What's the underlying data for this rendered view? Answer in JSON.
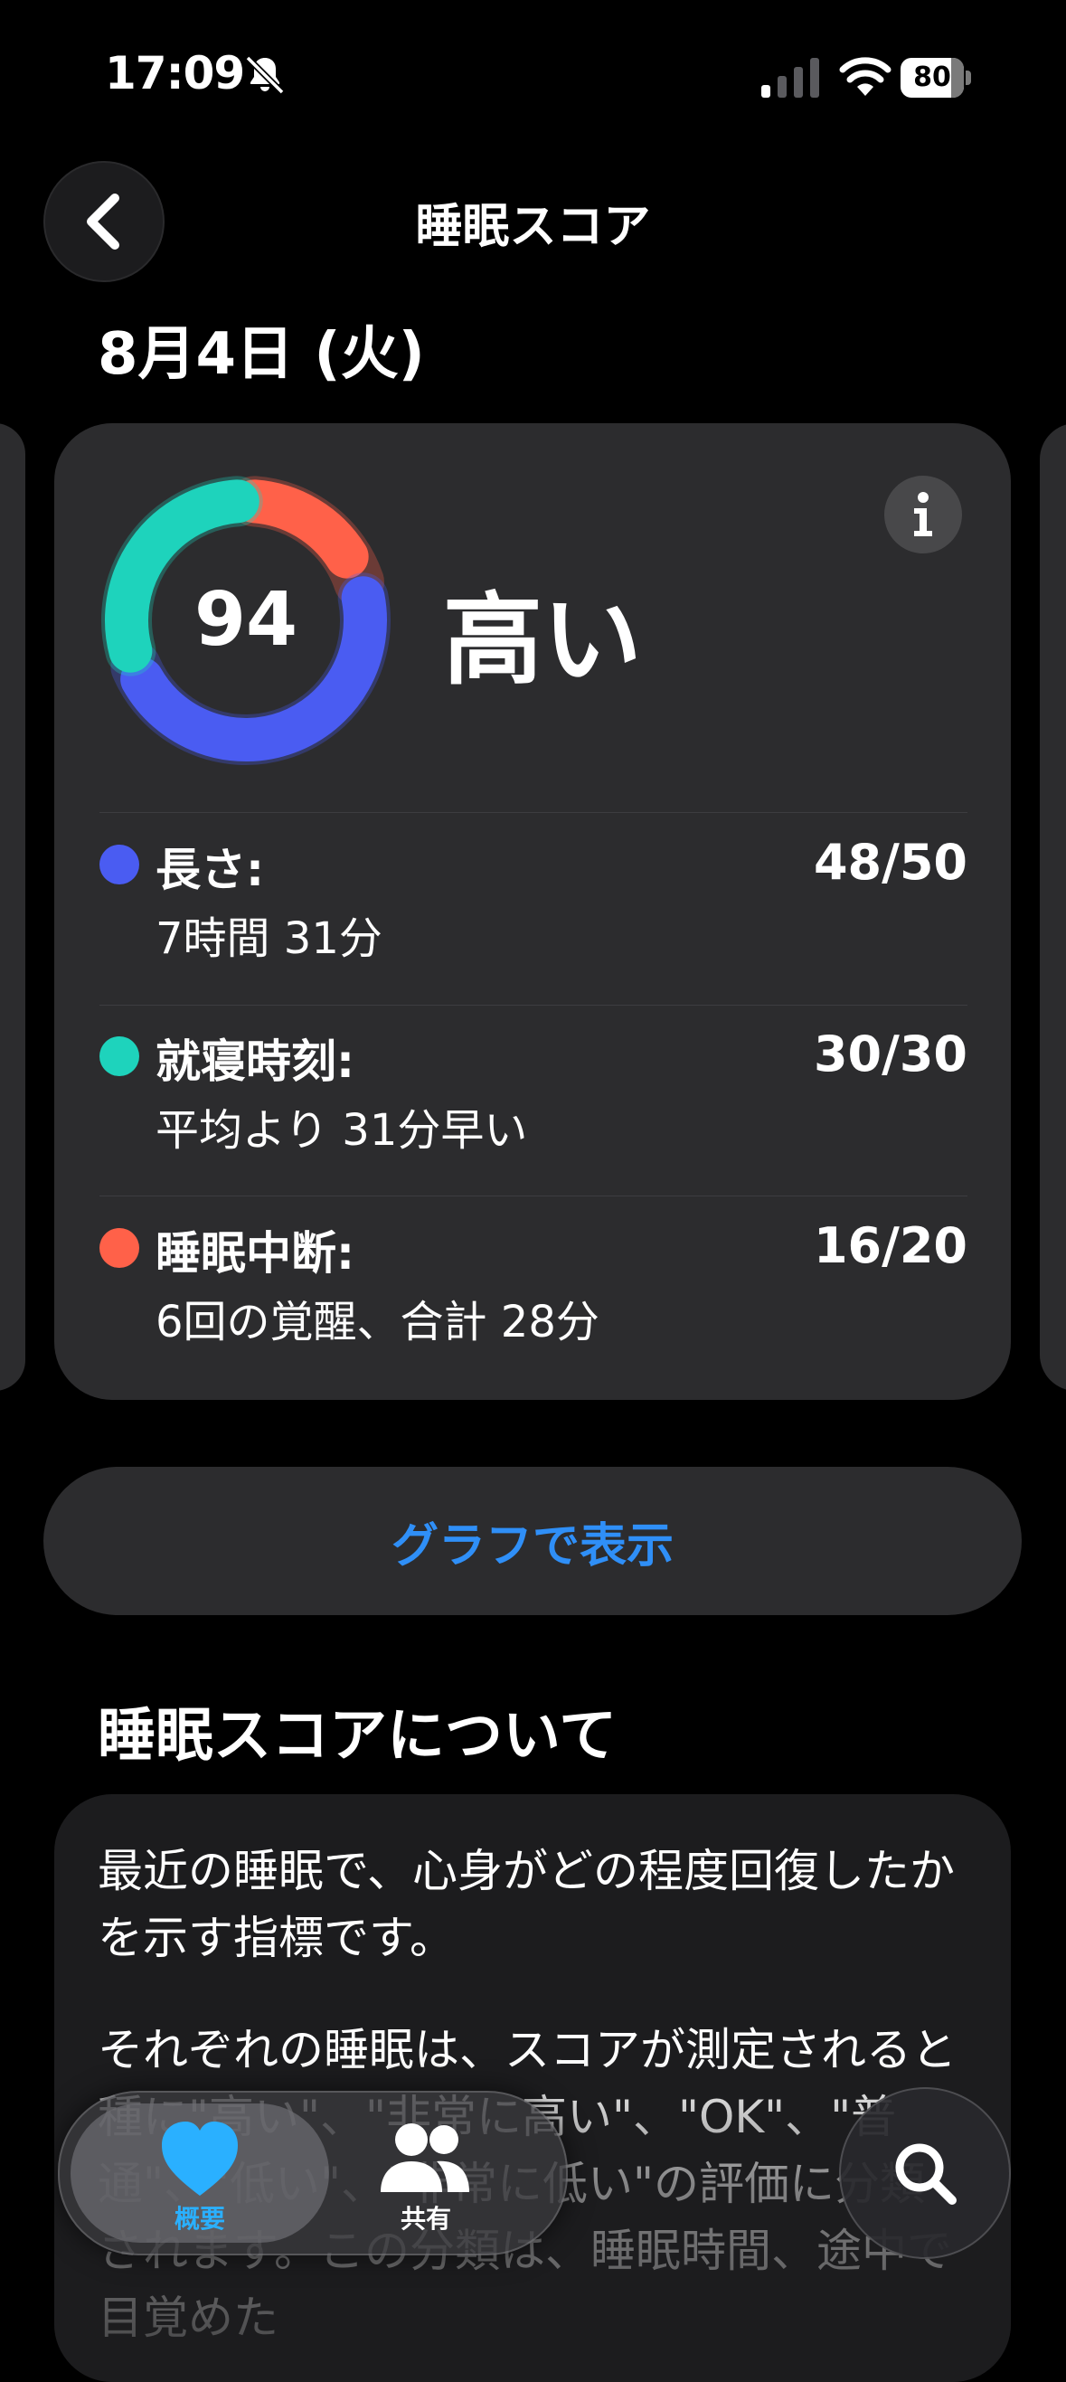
{
  "status_bar": {
    "time": "17:09",
    "battery": "80",
    "battery_level": 0.8
  },
  "header": {
    "title": "睡眠スコア",
    "back_icon": "chevron-left-icon"
  },
  "date": "8月4日 (火)",
  "score_card": {
    "score": "94",
    "rating": "高い",
    "ring_segments": [
      {
        "name": "長さ",
        "value": 48,
        "max": 50,
        "color": "#4a5cf2"
      },
      {
        "name": "就寝時刻",
        "value": 30,
        "max": 30,
        "color": "#1ed3bc"
      },
      {
        "name": "睡眠中断",
        "value": 16,
        "max": 20,
        "color": "#ff6149"
      }
    ],
    "metrics": [
      {
        "label": "長さ:",
        "score": "48/50",
        "detail": "7時間 31分",
        "color": "#4a5cf2"
      },
      {
        "label": "就寝時刻:",
        "score": "30/30",
        "detail": "平均より 31分早い",
        "color": "#1ed3bc"
      },
      {
        "label": "睡眠中断:",
        "score": "16/20",
        "detail": "6回の覚醒、合計 28分",
        "color": "#ff6149"
      }
    ]
  },
  "graph_button": "グラフで表示",
  "about": {
    "title": "睡眠スコアについて",
    "paragraph1": "最近の睡眠で、心身がどの程度回復したかを示す指標です。",
    "paragraph2": "それぞれの睡眠は、スコアが測定されると種に\"高い\"、\"非常に高い\"、\"OK\"、\"普通\"、\"低い\"、\"非常に低い\"の評価に分類されます。この分類は、睡眠時間、途中で目覚めた"
  },
  "tab_bar": {
    "tabs": [
      {
        "label": "概要",
        "icon": "heart-icon",
        "selected": true
      },
      {
        "label": "共有",
        "icon": "people-icon",
        "selected": false
      }
    ]
  },
  "search": {
    "icon": "search-icon"
  }
}
